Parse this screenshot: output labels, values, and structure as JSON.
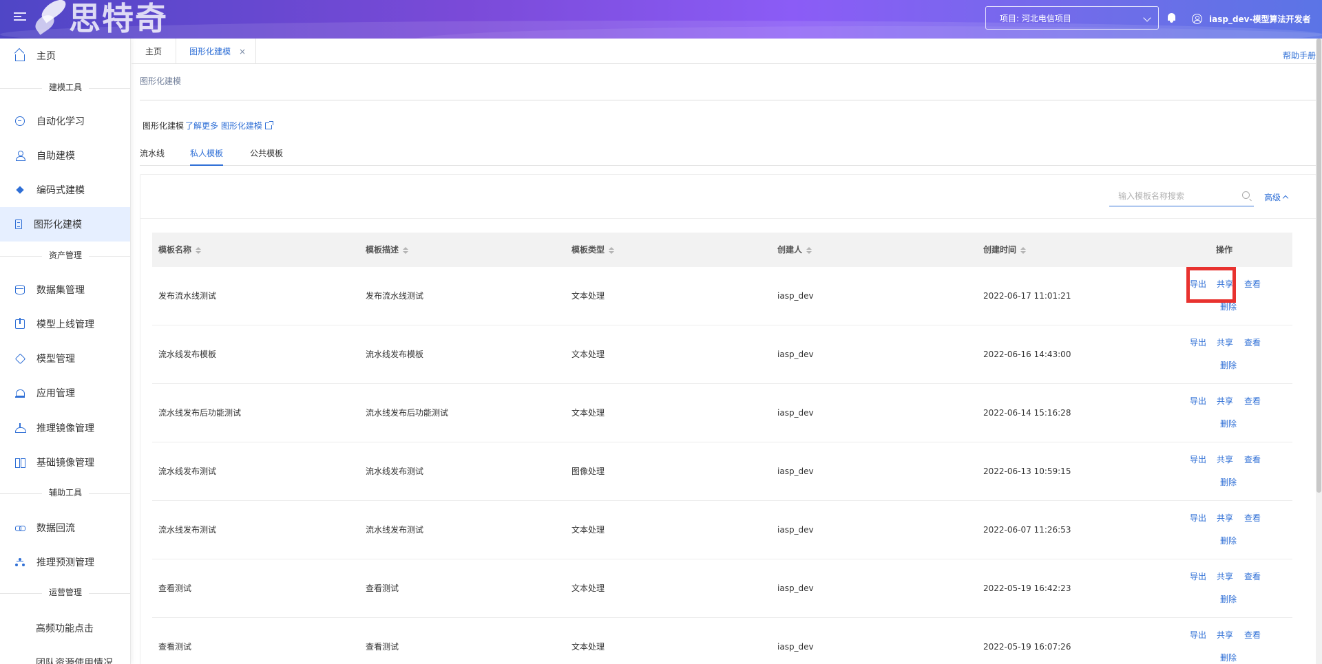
{
  "header": {
    "logo_text": "思特奇",
    "project_label": "项目: 河北电信项目",
    "user_label": "iasp_dev-模型算法开发者"
  },
  "sidebar": {
    "items": [
      {
        "label": "主页",
        "icon": "home-icon"
      },
      {
        "group": "建模工具"
      },
      {
        "label": "自动化学习",
        "icon": "auto-learning-icon"
      },
      {
        "label": "自助建模",
        "icon": "self-modeling-icon"
      },
      {
        "label": "编码式建模",
        "icon": "code-modeling-icon"
      },
      {
        "label": "图形化建模",
        "icon": "graphic-modeling-icon",
        "active": true
      },
      {
        "group": "资产管理"
      },
      {
        "label": "数据集管理",
        "icon": "dataset-icon"
      },
      {
        "label": "模型上线管理",
        "icon": "model-deploy-icon"
      },
      {
        "label": "模型管理",
        "icon": "model-icon"
      },
      {
        "label": "应用管理",
        "icon": "app-icon"
      },
      {
        "label": "推理镜像管理",
        "icon": "inference-image-icon"
      },
      {
        "label": "基础镜像管理",
        "icon": "base-image-icon"
      },
      {
        "group": "辅助工具"
      },
      {
        "label": "数据回流",
        "icon": "data-reflow-icon"
      },
      {
        "label": "推理预测管理",
        "icon": "inference-predict-icon"
      },
      {
        "group": "运营管理"
      },
      {
        "label": "高频功能点击"
      },
      {
        "label": "团队资源使用情况"
      }
    ]
  },
  "tabs": {
    "home": "主页",
    "current": "图形化建模",
    "close": "×",
    "help": "帮助手册"
  },
  "breadcrumb": "图形化建模",
  "intro": {
    "title": "图形化建模",
    "link": "了解更多 图形化建模"
  },
  "sub_tabs": [
    "流水线",
    "私人模板",
    "公共模板"
  ],
  "search": {
    "placeholder": "输入模板名称搜索",
    "advanced": "高级"
  },
  "table": {
    "columns": [
      "模板名称",
      "模板描述",
      "模板类型",
      "创建人",
      "创建时间",
      "操作"
    ],
    "rows": [
      [
        "发布流水线测试",
        "发布流水线测试",
        "文本处理",
        "iasp_dev",
        "2022-06-17 11:01:21"
      ],
      [
        "流水线发布模板",
        "流水线发布模板",
        "文本处理",
        "iasp_dev",
        "2022-06-16 14:43:00"
      ],
      [
        "流水线发布后功能测试",
        "流水线发布后功能测试",
        "文本处理",
        "iasp_dev",
        "2022-06-14 15:16:28"
      ],
      [
        "流水线发布测试",
        "流水线发布测试",
        "图像处理",
        "iasp_dev",
        "2022-06-13 10:59:15"
      ],
      [
        "流水线发布测试",
        "流水线发布测试",
        "文本处理",
        "iasp_dev",
        "2022-06-07 11:26:53"
      ],
      [
        "查看测试",
        "查看测试",
        "文本处理",
        "iasp_dev",
        "2022-05-19 16:42:23"
      ],
      [
        "查看测试",
        "查看测试",
        "文本处理",
        "iasp_dev",
        "2022-05-19 16:07:26"
      ]
    ],
    "actions": {
      "export": "导出",
      "share": "共享",
      "view": "查看",
      "delete": "删除"
    }
  },
  "colors": {
    "accent": "#2f6fd6",
    "highlight_box": "#e8322f",
    "active_side_bg": "#e6efff"
  }
}
